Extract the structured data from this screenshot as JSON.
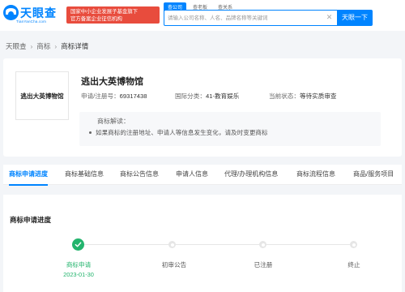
{
  "header": {
    "logo_text": "天眼查",
    "logo_sub": "TianYanCha.com",
    "badge_line1": "国家中小企业发展子基金旗下",
    "badge_line2": "官方备案企业征信机构",
    "search_tabs": [
      "查公司",
      "查老板",
      "查关系"
    ],
    "search_placeholder": "请输入公司名称、人名、品牌名称等关键词",
    "search_button": "天眼一下"
  },
  "breadcrumb": [
    "天眼查",
    "商标",
    "商标详情"
  ],
  "trademark": {
    "image_text": "逃出大英博物馆",
    "name": "逃出大英博物馆",
    "reg_label": "申请/注册号：",
    "reg_no": "69317438",
    "class_label": "国际分类：",
    "class_value": "41-教育娱乐",
    "status_label": "当前状态：",
    "status_value": "等待实质审查",
    "hint_title": "商标解读：",
    "hint_item": "如果商标的注册地址、申请人等信息发生变化，请及时变更商标"
  },
  "tabs": [
    "商标申请进度",
    "商标基础信息",
    "商标公告信息",
    "申请人信息",
    "代理/办理机构信息",
    "商标流程信息",
    "商品/服务项目"
  ],
  "progress": {
    "title": "商标申请进度",
    "steps": [
      {
        "label": "商标申请",
        "date": "2023-01-30",
        "done": true
      },
      {
        "label": "初审公告",
        "done": false
      },
      {
        "label": "已注册",
        "done": false
      },
      {
        "label": "终止",
        "done": false
      }
    ]
  },
  "colors": {
    "accent": "#0084ff",
    "badge": "#e84c3d",
    "success": "#23b46d"
  }
}
